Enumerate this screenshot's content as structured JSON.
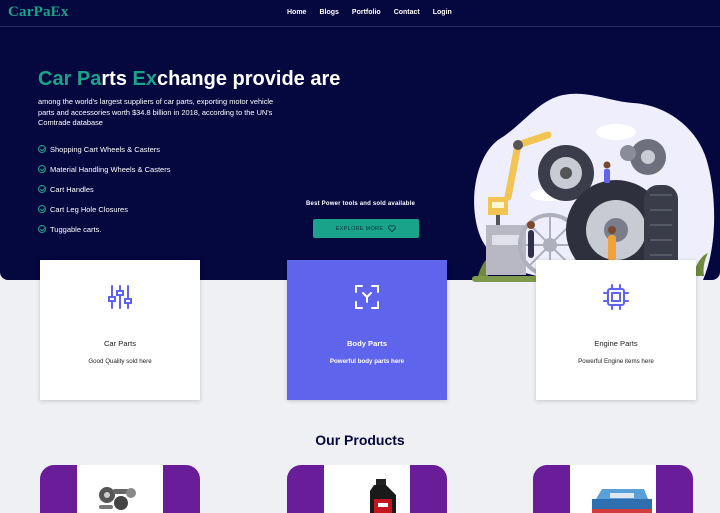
{
  "brand": {
    "logo": "CarPaEx"
  },
  "nav": {
    "items": [
      "Home",
      "Blogs",
      "Portfolio",
      "Contact",
      "Login"
    ]
  },
  "hero": {
    "title_parts": [
      "Car Pa",
      "rts ",
      "Ex",
      "change provide are"
    ],
    "subtitle": "among the world's largest suppliers of car parts, exporting motor vehicle parts and accessories worth $34.8 billion in 2018, according to the UN's Comtrade database",
    "features": [
      "Shopping Cart Wheels & Casters",
      "Material Handling Wheels & Casters",
      "Cart Handles",
      "Cart Leg Hole Closures",
      "Tuggable carts."
    ],
    "tools_text": "Best Power tools and sold available",
    "cta_label": "EXPLORE MORE",
    "cta_icon": "heart-icon"
  },
  "services": [
    {
      "title": "Car Parts",
      "desc": "Good Quality sold here",
      "icon": "sliders-icon"
    },
    {
      "title": "Body Parts",
      "desc": "Powerful body parts here",
      "icon": "fullscreen-icon"
    },
    {
      "title": "Engine Parts",
      "desc": "Powerful Engine items here",
      "icon": "cpu-icon"
    }
  ],
  "colors": {
    "navy": "#05073f",
    "teal": "#19a38b",
    "accent": "#5f64ec",
    "purple": "#6a1d98"
  },
  "products_section": {
    "title": "Our Products"
  }
}
